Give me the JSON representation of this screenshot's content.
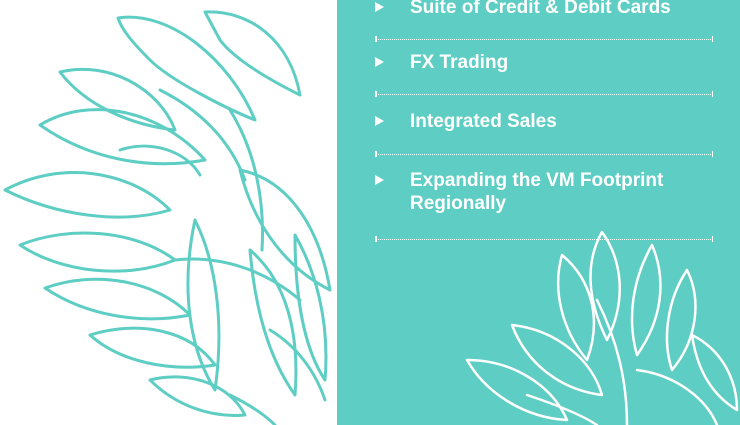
{
  "colors": {
    "accent": "#5ecdc3",
    "outline": "#5ecdc3",
    "text": "#ffffff"
  },
  "decor": {
    "left": "leaf-outline-illustration",
    "right": "leaf-outline-illustration"
  },
  "items": [
    {
      "label": "Suite of Credit & Debit Cards",
      "icon": "triangle-bullet-icon"
    },
    {
      "label": "FX Trading",
      "icon": "triangle-bullet-icon"
    },
    {
      "label": "Integrated Sales",
      "icon": "triangle-bullet-icon"
    },
    {
      "label": "Expanding the VM Footprint Regionally",
      "icon": "triangle-bullet-icon"
    }
  ]
}
